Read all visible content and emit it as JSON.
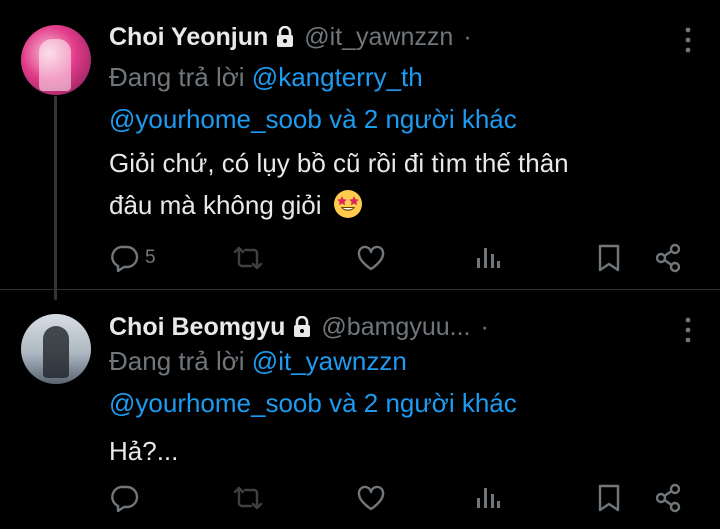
{
  "tweets": [
    {
      "name": "Choi Yeonjun",
      "handle": "@it_yawnzzn",
      "dot": "·",
      "replying_prefix": "Đang trả lời",
      "replying_to": "@kangterry_th",
      "replying_line2_handle": "@yourhome_soob",
      "replying_line2_suffix": "và 2 người khác",
      "text_line1": "Giỏi chứ, có lụy bồ cũ rồi đi tìm thế thân",
      "text_line2": "đâu mà không giỏi",
      "emoji": "star-struck-emoji",
      "reply_count": "5",
      "avatar_colors": [
        "#f7c6d6",
        "#e23b8a"
      ]
    },
    {
      "name": "Choi Beomgyu",
      "handle": "@bamgyuu...",
      "dot": "·",
      "replying_prefix": "Đang trả lời",
      "replying_to": "@it_yawnzzn",
      "replying_line2_handle": "@yourhome_soob",
      "replying_line2_suffix": "và 2 người khác",
      "text_line1": "Hả?...",
      "reply_count": ""
    }
  ],
  "icons": {
    "reply": "reply-icon",
    "retweet": "retweet-icon",
    "like": "heart-icon",
    "views": "views-icon",
    "bookmark": "bookmark-icon",
    "share": "share-icon",
    "lock": "lock-icon",
    "more": "more-vertical-icon"
  },
  "colors": {
    "background": "#000000",
    "text": "#e7e9ea",
    "secondary": "#71767b",
    "accent": "#1d9bf0",
    "retweet_icon": "#3e4144"
  }
}
